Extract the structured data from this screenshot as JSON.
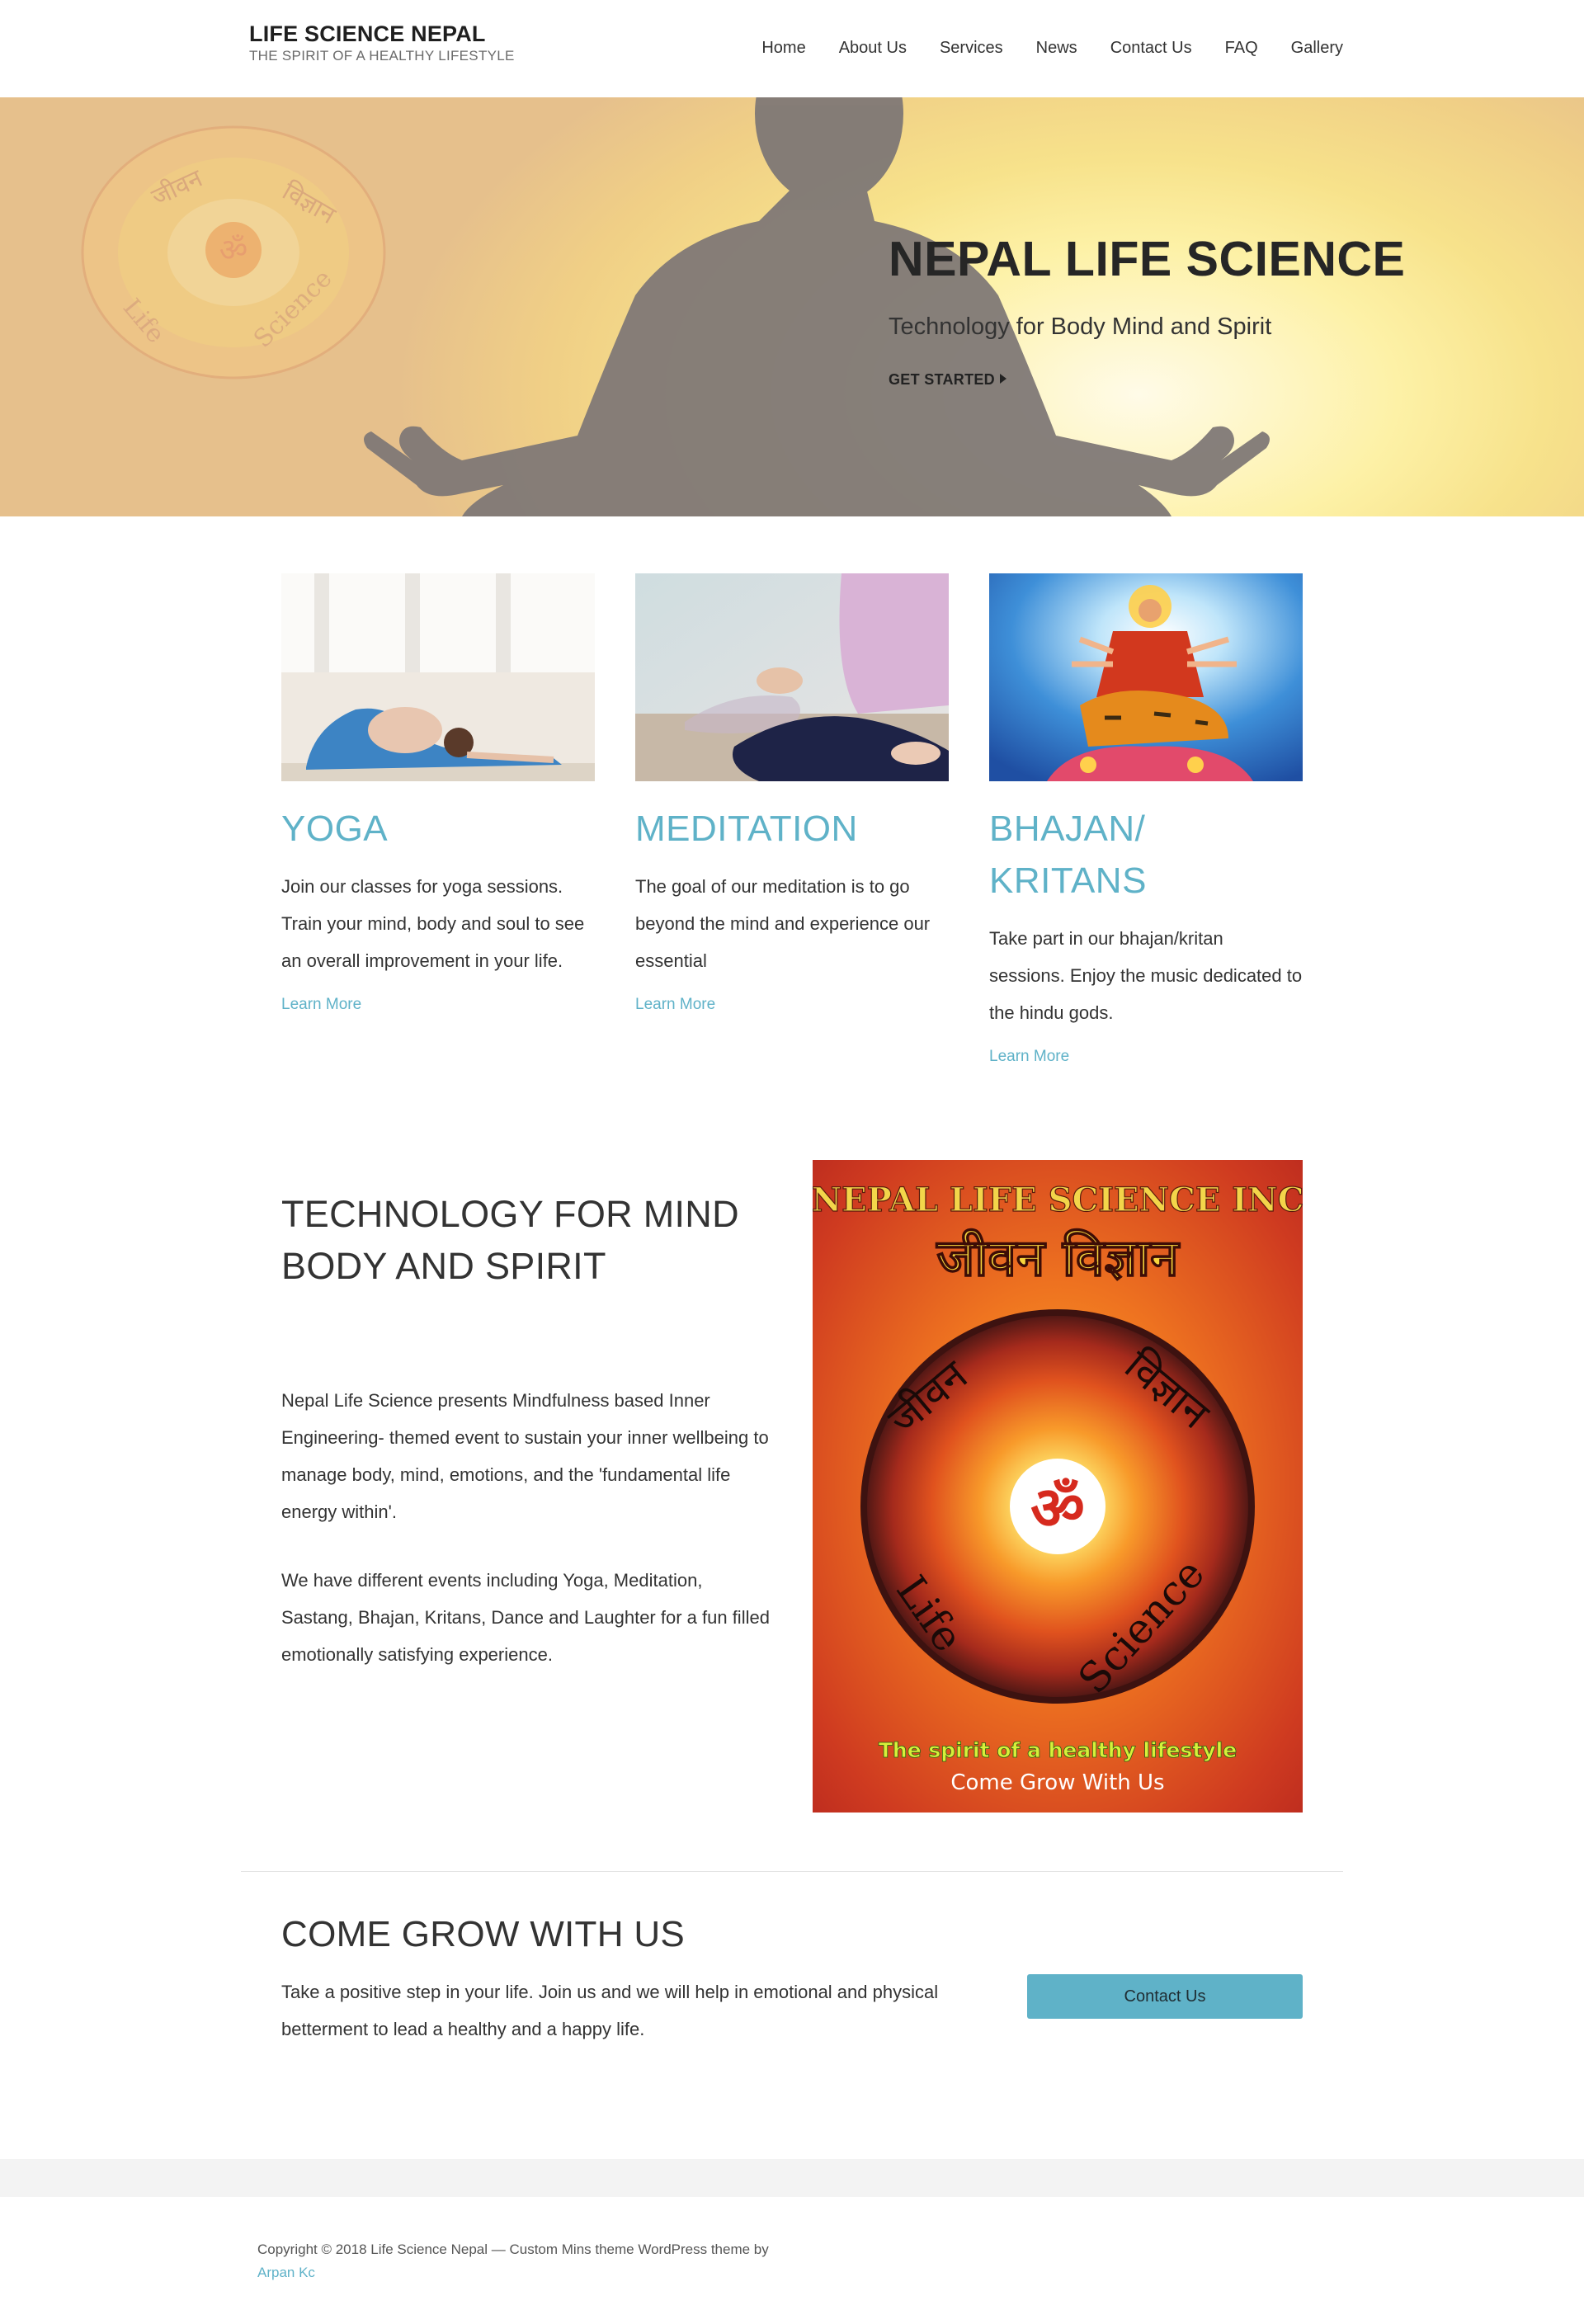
{
  "site": {
    "title": "LIFE SCIENCE NEPAL",
    "tagline": "THE SPIRIT OF A HEALTHY LIFESTYLE"
  },
  "nav": [
    "Home",
    "About Us",
    "Services",
    "News",
    "Contact Us",
    "FAQ",
    "Gallery"
  ],
  "hero": {
    "title": "NEPAL LIFE SCIENCE",
    "subtitle": "Technology for Body Mind and Spirit",
    "cta": "GET STARTED",
    "logo_left_text": "जीवन",
    "logo_right_text": "विज्ञान",
    "logo_bottom_left": "Life",
    "logo_bottom_right": "Science",
    "om": "ॐ"
  },
  "services": [
    {
      "title": "YOGA",
      "body": "Join our classes for yoga sessions. Train your mind, body and soul to see an overall improvement in your life.",
      "link": "Learn More"
    },
    {
      "title": "MEDITATION",
      "body": "The goal of our meditation is to go beyond the mind and experience our essential",
      "link": "Learn More"
    },
    {
      "title": "BHAJAN/ KRITANS",
      "body": "Take part in our bhajan/kritan sessions. Enjoy the music dedicated to the hindu gods.",
      "link": "Learn More"
    }
  ],
  "about": {
    "heading": "TECHNOLOGY FOR MIND BODY AND SPIRIT",
    "para1": "Nepal Life Science presents Mindfulness based Inner Engineering- themed event to sustain your inner wellbeing to manage body, mind, emotions, and the 'fundamental life energy within'.",
    "para2": "We have different events including Yoga, Meditation, Sastang, Bhajan, Kritans, Dance and Laughter for a fun filled emotionally satisfying experience."
  },
  "poster": {
    "top": "NEPAL LIFE SCIENCE INC",
    "devanagari": "जीवन विज्ञान",
    "ring_left": "जीवन",
    "ring_right": "विज्ञान",
    "ring_bottom_left": "Life",
    "ring_bottom_right": "Science",
    "om": "ॐ",
    "slogan": "The spirit of a healthy lifestyle",
    "bottom": "Come Grow With Us"
  },
  "cta": {
    "heading": "COME GROW WITH US",
    "body": "Take a positive step in your life. Join us and we will help in emotional and physical betterment to lead a healthy and a happy life.",
    "button": "Contact Us"
  },
  "footer": {
    "text": "Copyright © 2018 Life Science Nepal — Custom Mins theme WordPress theme by",
    "author": "Arpan Kc"
  },
  "colors": {
    "accent": "#5fb2c8",
    "heading": "#333333",
    "poster_red": "#c0312a",
    "poster_orange": "#f08a20"
  }
}
